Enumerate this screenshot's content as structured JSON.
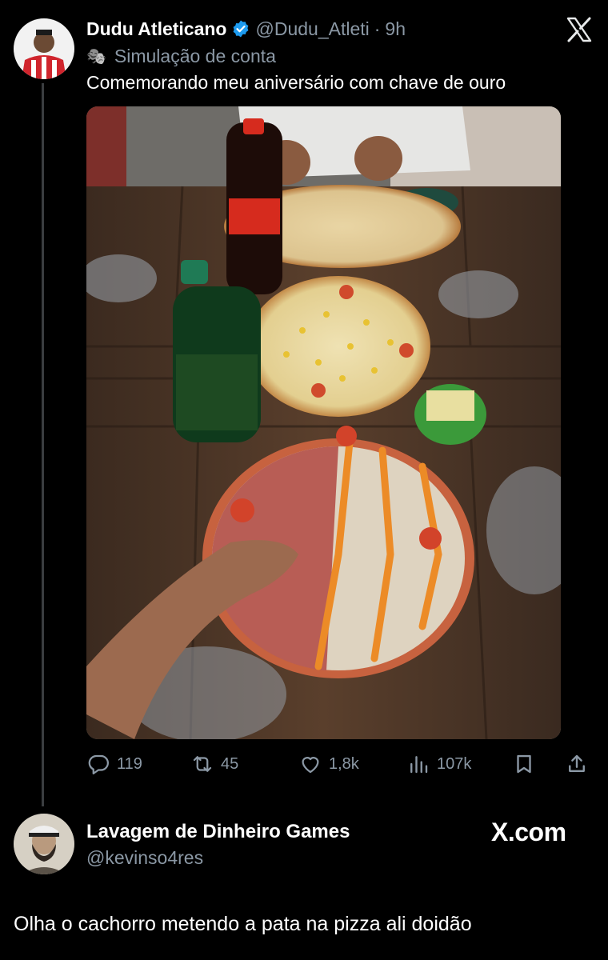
{
  "tweet": {
    "author_name": "Dudu Atleticano",
    "handle": "@Dudu_Atleti",
    "separator": "·",
    "time": "9h",
    "label_emoji": "🎭",
    "label": "Simulação de conta",
    "text": "Comemorando meu aniversário com chave de ouro",
    "actions": {
      "replies": "119",
      "reposts": "45",
      "likes": "1,8k",
      "views": "107k"
    }
  },
  "x_logo": "X",
  "footer": {
    "author_name": "Lavagem de Dinheiro Games",
    "handle": "@kevinso4res",
    "brand": "X.com",
    "text": "Olha o cachorro metendo a pata na pizza ali doidão"
  },
  "colors": {
    "background": "#000000",
    "muted": "#8b98a5",
    "verified": "#1d9bf0"
  }
}
